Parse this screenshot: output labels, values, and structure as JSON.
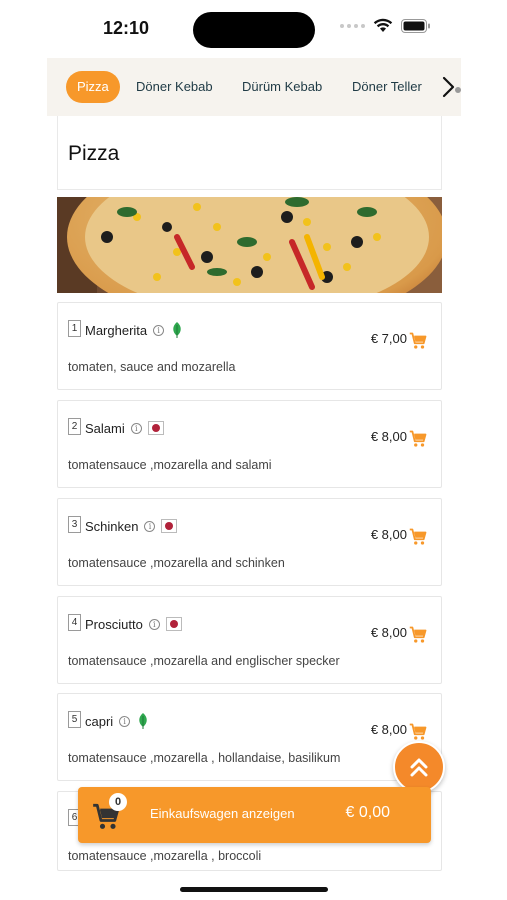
{
  "status": {
    "time": "12:10"
  },
  "tabs": [
    {
      "label": "Pizza",
      "active": true
    },
    {
      "label": "Döner Kebab",
      "active": false
    },
    {
      "label": "Dürüm Kebab",
      "active": false
    },
    {
      "label": "Döner Teller",
      "active": false
    }
  ],
  "category": {
    "title": "Pizza"
  },
  "products": [
    {
      "number": "1",
      "name": "Margherita",
      "price": "€ 7,00",
      "description": "tomaten, sauce and mozarella",
      "badge": "veg"
    },
    {
      "number": "2",
      "name": "Salami",
      "price": "€ 8,00",
      "description": "tomatensauce ,mozarella and salami",
      "badge": "meat"
    },
    {
      "number": "3",
      "name": "Schinken",
      "price": "€ 8,00",
      "description": "tomatensauce ,mozarella and schinken",
      "badge": "meat"
    },
    {
      "number": "4",
      "name": "Prosciutto",
      "price": "€ 8,00",
      "description": "tomatensauce ,mozarella and englischer specker",
      "badge": "meat"
    },
    {
      "number": "5",
      "name": "capri",
      "price": "€ 8,00",
      "description": "tomatensauce ,mozarella , hollandaise, basilikum",
      "badge": "veg"
    },
    {
      "number": "6",
      "name": "",
      "price": "",
      "description": "tomatensauce ,mozarella , broccoli",
      "badge": ""
    }
  ],
  "cart": {
    "count": "0",
    "label": "Einkaufswagen anzeigen",
    "total": "€ 0,00"
  },
  "colors": {
    "accent": "#f7982a",
    "veg": "#2fa84f",
    "meat": "#b1223a",
    "tab_bg": "#f6f3ee"
  },
  "icons": {
    "tabs_next": "chevron-right-icon",
    "info": "info-icon",
    "add_to_cart": "cart-add-icon",
    "scroll_top": "double-chevron-up-icon",
    "cart": "shopping-cart-icon"
  }
}
